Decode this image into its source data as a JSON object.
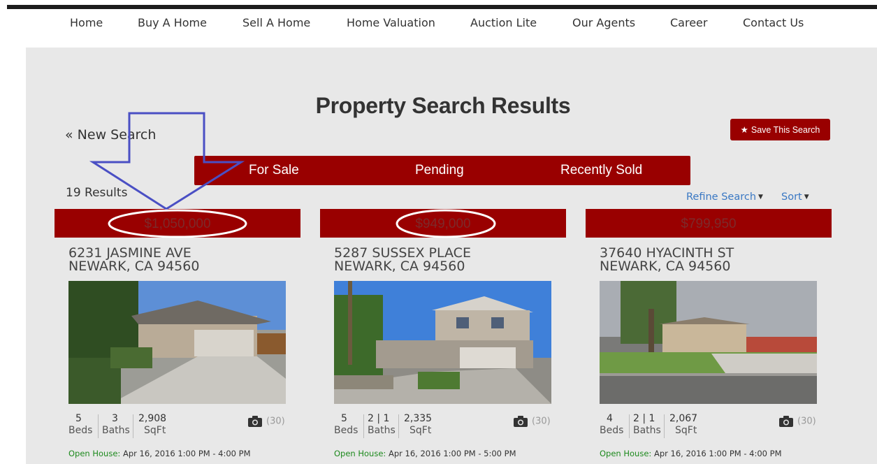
{
  "nav": {
    "items": [
      "Home",
      "Buy A Home",
      "Sell A Home",
      "Home Valuation",
      "Auction Lite",
      "Our Agents",
      "Career",
      "Contact Us"
    ]
  },
  "page": {
    "title": "Property Search Results",
    "new_search": "« New Search",
    "save_search": "Save This Search",
    "results_count": "19 Results",
    "refine_search": "Refine Search",
    "sort": "Sort"
  },
  "status_tabs": [
    "For Sale",
    "Pending",
    "Recently Sold"
  ],
  "listings": [
    {
      "price": "$1,050,000",
      "street": "6231 JASMINE AVE",
      "city": "NEWARK, CA 94560",
      "beds": "5",
      "baths": "3",
      "sqft": "2,908",
      "beds_label": "Beds",
      "baths_label": "Baths",
      "sqft_label": "SqFt",
      "photo_count": "(30)",
      "open_house_label": "Open House:",
      "open_house_time": "Apr 16, 2016 1:00 PM - 4:00 PM"
    },
    {
      "price": "$949,000",
      "street": "5287 SUSSEX PLACE",
      "city": "NEWARK, CA 94560",
      "beds": "5",
      "baths": "2 | 1",
      "sqft": "2,335",
      "beds_label": "Beds",
      "baths_label": "Baths",
      "sqft_label": "SqFt",
      "photo_count": "(30)",
      "open_house_label": "Open House:",
      "open_house_time": "Apr 16, 2016 1:00 PM - 5:00 PM"
    },
    {
      "price": "$799,950",
      "street": "37640 HYACINTH ST",
      "city": "NEWARK, CA 94560",
      "beds": "4",
      "baths": "2 | 1",
      "sqft": "2,067",
      "beds_label": "Beds",
      "baths_label": "Baths",
      "sqft_label": "SqFt",
      "photo_count": "(30)",
      "open_house_label": "Open House:",
      "open_house_time": "Apr 16, 2016 1:00 PM - 4:00 PM"
    }
  ],
  "colors": {
    "brand_red": "#990000",
    "link_blue": "#3a78c3",
    "open_house_green": "#1e8a1e",
    "annotation_blue": "#4a4fc4"
  },
  "icons": [
    "star-icon",
    "camera-icon",
    "caret-down-icon"
  ]
}
